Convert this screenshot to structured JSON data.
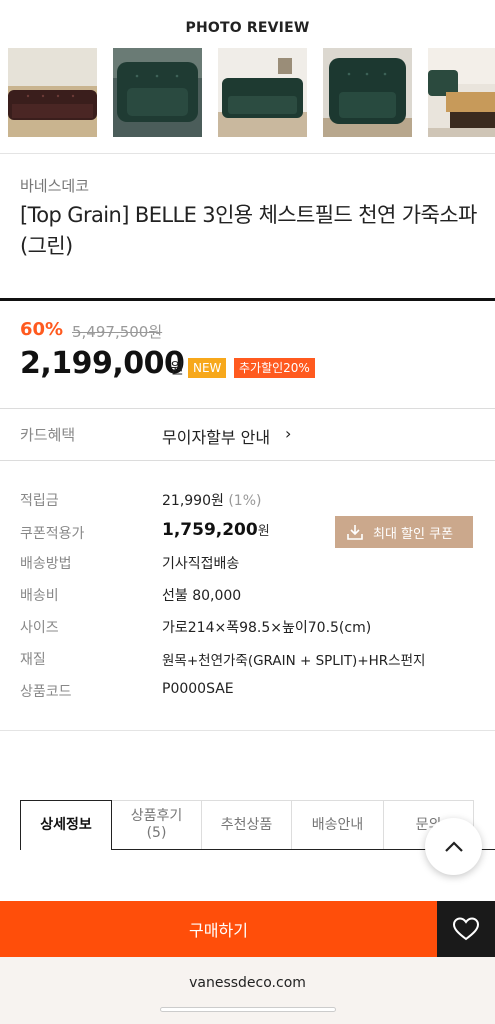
{
  "photo_review": {
    "title": "PHOTO REVIEW",
    "thumbnails": [
      "sofa-photo-1",
      "sofa-photo-2",
      "sofa-photo-3",
      "sofa-photo-4",
      "sofa-photo-5"
    ]
  },
  "product": {
    "brand": "바네스데코",
    "title": "[Top Grain] BELLE 3인용 체스트필드 천연 가죽소파(그린)",
    "discount": "60%",
    "original_price": "5,497,500원",
    "price": "2,199,000",
    "currency": "원",
    "badge_new": "NEW",
    "badge_extra": "추가할인20%"
  },
  "card_benefit": {
    "label": "카드혜택",
    "value": "무이자할부 안내",
    "chevron": "›"
  },
  "info": {
    "points_label": "적립금",
    "points_value": "21,990원",
    "points_pct": "(1%)",
    "coupon_price_label": "쿠폰적용가",
    "coupon_price_value": "1,759,200",
    "coupon_price_unit": "원",
    "coupon_button": "최대 할인 쿠폰",
    "shipping_method_label": "배송방법",
    "shipping_method_value": "기사직접배송",
    "shipping_fee_label": "배송비",
    "shipping_fee_value": "선불 80,000",
    "size_label": "사이즈",
    "size_value": "가로214×폭98.5×높이70.5(cm)",
    "material_label": "재질",
    "material_value": "원목+천연가죽(GRAIN + SPLIT)+HR스펀지",
    "code_label": "상품코드",
    "code_value": "P0000SAE"
  },
  "tabs": {
    "detail": "상세정보",
    "review_line1": "상품후기",
    "review_line2": "(5)",
    "recommend": "추천상품",
    "shipping": "배송안내",
    "inquiry": "문의"
  },
  "bottom": {
    "buy_label": "구매하기",
    "url": "vanessdeco.com"
  },
  "colors": {
    "accent": "#ff4e0a",
    "discount": "#ff5a1f",
    "badge_new": "#f7a81b",
    "coupon_button": "#cba88c"
  },
  "icons": [
    "download-icon",
    "chevron-up-icon",
    "heart-icon",
    "chevron-right-icon"
  ]
}
